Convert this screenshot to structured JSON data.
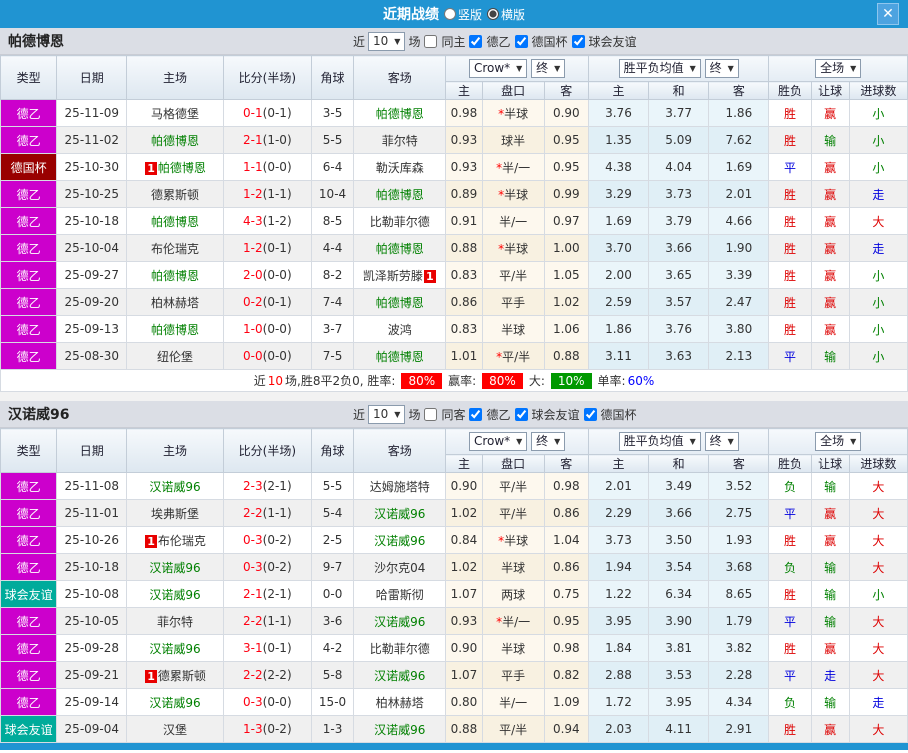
{
  "titlebar": {
    "title": "近期战绩",
    "radios": [
      {
        "label": "竖版",
        "selected": false
      },
      {
        "label": "横版",
        "selected": true
      }
    ],
    "close_label": "X"
  },
  "colors": {
    "titlebar": "#2094d2",
    "types": {
      "德乙": "#cc00cc",
      "德国杯": "#990000",
      "球会友谊": "#00ab9b"
    },
    "highlight_team": "#008000",
    "score_red": "#ff0012"
  },
  "table_header": {
    "left": [
      "类型",
      "日期",
      "主场",
      "比分(半场)",
      "角球",
      "客场"
    ],
    "odds_select": "Crow*",
    "odds_final_select": "终",
    "odds_cols": [
      "主",
      "盘口",
      "客"
    ],
    "mean_select": "胜平负均值",
    "mean_final_select": "终",
    "mean_cols": [
      "主",
      "和",
      "客"
    ],
    "result_select": "全场",
    "result_cols": [
      "胜负",
      "让球",
      "进球数"
    ]
  },
  "sections": [
    {
      "team": "帕德博恩",
      "filter": {
        "near_label": "近",
        "count": "10",
        "games_label": "场",
        "same": {
          "label": "同主",
          "checked": false
        },
        "comps": [
          {
            "label": "德乙",
            "checked": true
          },
          {
            "label": "德国杯",
            "checked": true
          },
          {
            "label": "球会友谊",
            "checked": true
          }
        ]
      },
      "rows": [
        {
          "type": "德乙",
          "date": "25-11-09",
          "home": "马格德堡",
          "home_hl": false,
          "home_badge": "",
          "score": "0-1",
          "half": "(0-1)",
          "corner": "3-5",
          "away": "帕德博恩",
          "away_hl": true,
          "away_badge": "",
          "odds": [
            "0.98",
            "半球",
            "0.90"
          ],
          "star": true,
          "mean": [
            "3.76",
            "3.77",
            "1.86"
          ],
          "res": [
            [
              "胜",
              "r"
            ],
            [
              "赢",
              "r"
            ],
            [
              "小",
              "g"
            ]
          ]
        },
        {
          "type": "德乙",
          "date": "25-11-02",
          "home": "帕德博恩",
          "home_hl": true,
          "home_badge": "",
          "score": "2-1",
          "half": "(1-0)",
          "corner": "5-5",
          "away": "菲尔特",
          "away_hl": false,
          "away_badge": "",
          "odds": [
            "0.93",
            "球半",
            "0.95"
          ],
          "star": false,
          "mean": [
            "1.35",
            "5.09",
            "7.62"
          ],
          "res": [
            [
              "胜",
              "r"
            ],
            [
              "输",
              "g"
            ],
            [
              "小",
              "g"
            ]
          ]
        },
        {
          "type": "德国杯",
          "date": "25-10-30",
          "home": "帕德博恩",
          "home_hl": true,
          "home_badge": "before",
          "score": "1-1",
          "half": "(0-0)",
          "corner": "6-4",
          "away": "勒沃库森",
          "away_hl": false,
          "away_badge": "",
          "odds": [
            "0.93",
            "半/一",
            "0.95"
          ],
          "star": true,
          "mean": [
            "4.38",
            "4.04",
            "1.69"
          ],
          "res": [
            [
              "平",
              "b"
            ],
            [
              "赢",
              "r"
            ],
            [
              "小",
              "g"
            ]
          ]
        },
        {
          "type": "德乙",
          "date": "25-10-25",
          "home": "德累斯顿",
          "home_hl": false,
          "home_badge": "",
          "score": "1-2",
          "half": "(1-1)",
          "corner": "10-4",
          "away": "帕德博恩",
          "away_hl": true,
          "away_badge": "",
          "odds": [
            "0.89",
            "半球",
            "0.99"
          ],
          "star": true,
          "mean": [
            "3.29",
            "3.73",
            "2.01"
          ],
          "res": [
            [
              "胜",
              "r"
            ],
            [
              "赢",
              "r"
            ],
            [
              "走",
              "b"
            ]
          ]
        },
        {
          "type": "德乙",
          "date": "25-10-18",
          "home": "帕德博恩",
          "home_hl": true,
          "home_badge": "",
          "score": "4-3",
          "half": "(1-2)",
          "corner": "8-5",
          "away": "比勒菲尔德",
          "away_hl": false,
          "away_badge": "",
          "odds": [
            "0.91",
            "半/一",
            "0.97"
          ],
          "star": false,
          "mean": [
            "1.69",
            "3.79",
            "4.66"
          ],
          "res": [
            [
              "胜",
              "r"
            ],
            [
              "赢",
              "r"
            ],
            [
              "大",
              "r"
            ]
          ]
        },
        {
          "type": "德乙",
          "date": "25-10-04",
          "home": "布伦瑞克",
          "home_hl": false,
          "home_badge": "",
          "score": "1-2",
          "half": "(0-1)",
          "corner": "4-4",
          "away": "帕德博恩",
          "away_hl": true,
          "away_badge": "",
          "odds": [
            "0.88",
            "半球",
            "1.00"
          ],
          "star": true,
          "mean": [
            "3.70",
            "3.66",
            "1.90"
          ],
          "res": [
            [
              "胜",
              "r"
            ],
            [
              "赢",
              "r"
            ],
            [
              "走",
              "b"
            ]
          ]
        },
        {
          "type": "德乙",
          "date": "25-09-27",
          "home": "帕德博恩",
          "home_hl": true,
          "home_badge": "",
          "score": "2-0",
          "half": "(0-0)",
          "corner": "8-2",
          "away": "凯泽斯劳滕",
          "away_hl": false,
          "away_badge": "after",
          "odds": [
            "0.83",
            "平/半",
            "1.05"
          ],
          "star": false,
          "mean": [
            "2.00",
            "3.65",
            "3.39"
          ],
          "res": [
            [
              "胜",
              "r"
            ],
            [
              "赢",
              "r"
            ],
            [
              "小",
              "g"
            ]
          ]
        },
        {
          "type": "德乙",
          "date": "25-09-20",
          "home": "柏林赫塔",
          "home_hl": false,
          "home_badge": "",
          "score": "0-2",
          "half": "(0-1)",
          "corner": "7-4",
          "away": "帕德博恩",
          "away_hl": true,
          "away_badge": "",
          "odds": [
            "0.86",
            "平手",
            "1.02"
          ],
          "star": false,
          "mean": [
            "2.59",
            "3.57",
            "2.47"
          ],
          "res": [
            [
              "胜",
              "r"
            ],
            [
              "赢",
              "r"
            ],
            [
              "小",
              "g"
            ]
          ]
        },
        {
          "type": "德乙",
          "date": "25-09-13",
          "home": "帕德博恩",
          "home_hl": true,
          "home_badge": "",
          "score": "1-0",
          "half": "(0-0)",
          "corner": "3-7",
          "away": "波鸿",
          "away_hl": false,
          "away_badge": "",
          "odds": [
            "0.83",
            "半球",
            "1.06"
          ],
          "star": false,
          "mean": [
            "1.86",
            "3.76",
            "3.80"
          ],
          "res": [
            [
              "胜",
              "r"
            ],
            [
              "赢",
              "r"
            ],
            [
              "小",
              "g"
            ]
          ]
        },
        {
          "type": "德乙",
          "date": "25-08-30",
          "home": "纽伦堡",
          "home_hl": false,
          "home_badge": "",
          "score": "0-0",
          "half": "(0-0)",
          "corner": "7-5",
          "away": "帕德博恩",
          "away_hl": true,
          "away_badge": "",
          "odds": [
            "1.01",
            "平/半",
            "0.88"
          ],
          "star": true,
          "mean": [
            "3.11",
            "3.63",
            "2.13"
          ],
          "res": [
            [
              "平",
              "b"
            ],
            [
              "输",
              "g"
            ],
            [
              "小",
              "g"
            ]
          ]
        }
      ],
      "summary": {
        "t1": "近",
        "n": "10",
        "t2": "场,胜8平2负0, 胜率:",
        "win_rate": "80%",
        "t3": "赢率:",
        "profit_rate": "80%",
        "t4": "大:",
        "big_rate": "10%",
        "t5": "单率:",
        "single_rate": "60%"
      }
    },
    {
      "team": "汉诺威96",
      "filter": {
        "near_label": "近",
        "count": "10",
        "games_label": "场",
        "same": {
          "label": "同客",
          "checked": false
        },
        "comps": [
          {
            "label": "德乙",
            "checked": true
          },
          {
            "label": "球会友谊",
            "checked": true
          },
          {
            "label": "德国杯",
            "checked": true
          }
        ]
      },
      "rows": [
        {
          "type": "德乙",
          "date": "25-11-08",
          "home": "汉诺威96",
          "home_hl": true,
          "home_badge": "",
          "score": "2-3",
          "half": "(2-1)",
          "corner": "5-5",
          "away": "达姆施塔特",
          "away_hl": false,
          "away_badge": "",
          "odds": [
            "0.90",
            "平/半",
            "0.98"
          ],
          "star": false,
          "mean": [
            "2.01",
            "3.49",
            "3.52"
          ],
          "res": [
            [
              "负",
              "g"
            ],
            [
              "输",
              "g"
            ],
            [
              "大",
              "r"
            ]
          ]
        },
        {
          "type": "德乙",
          "date": "25-11-01",
          "home": "埃弗斯堡",
          "home_hl": false,
          "home_badge": "",
          "score": "2-2",
          "half": "(1-1)",
          "corner": "5-4",
          "away": "汉诺威96",
          "away_hl": true,
          "away_badge": "",
          "odds": [
            "1.02",
            "平/半",
            "0.86"
          ],
          "star": false,
          "mean": [
            "2.29",
            "3.66",
            "2.75"
          ],
          "res": [
            [
              "平",
              "b"
            ],
            [
              "赢",
              "r"
            ],
            [
              "大",
              "r"
            ]
          ]
        },
        {
          "type": "德乙",
          "date": "25-10-26",
          "home": "布伦瑞克",
          "home_hl": false,
          "home_badge": "before",
          "score": "0-3",
          "half": "(0-2)",
          "corner": "2-5",
          "away": "汉诺威96",
          "away_hl": true,
          "away_badge": "",
          "odds": [
            "0.84",
            "半球",
            "1.04"
          ],
          "star": true,
          "mean": [
            "3.73",
            "3.50",
            "1.93"
          ],
          "res": [
            [
              "胜",
              "r"
            ],
            [
              "赢",
              "r"
            ],
            [
              "大",
              "r"
            ]
          ]
        },
        {
          "type": "德乙",
          "date": "25-10-18",
          "home": "汉诺威96",
          "home_hl": true,
          "home_badge": "",
          "score": "0-3",
          "half": "(0-2)",
          "corner": "9-7",
          "away": "沙尔克04",
          "away_hl": false,
          "away_badge": "",
          "odds": [
            "1.02",
            "半球",
            "0.86"
          ],
          "star": false,
          "mean": [
            "1.94",
            "3.54",
            "3.68"
          ],
          "res": [
            [
              "负",
              "g"
            ],
            [
              "输",
              "g"
            ],
            [
              "大",
              "r"
            ]
          ]
        },
        {
          "type": "球会友谊",
          "date": "25-10-08",
          "home": "汉诺威96",
          "home_hl": true,
          "home_badge": "",
          "score": "2-1",
          "half": "(2-1)",
          "corner": "0-0",
          "away": "哈雷斯彻",
          "away_hl": false,
          "away_badge": "",
          "odds": [
            "1.07",
            "两球",
            "0.75"
          ],
          "star": false,
          "mean": [
            "1.22",
            "6.34",
            "8.65"
          ],
          "res": [
            [
              "胜",
              "r"
            ],
            [
              "输",
              "g"
            ],
            [
              "小",
              "g"
            ]
          ]
        },
        {
          "type": "德乙",
          "date": "25-10-05",
          "home": "菲尔特",
          "home_hl": false,
          "home_badge": "",
          "score": "2-2",
          "half": "(1-1)",
          "corner": "3-6",
          "away": "汉诺威96",
          "away_hl": true,
          "away_badge": "",
          "odds": [
            "0.93",
            "半/一",
            "0.95"
          ],
          "star": true,
          "mean": [
            "3.95",
            "3.90",
            "1.79"
          ],
          "res": [
            [
              "平",
              "b"
            ],
            [
              "输",
              "g"
            ],
            [
              "大",
              "r"
            ]
          ]
        },
        {
          "type": "德乙",
          "date": "25-09-28",
          "home": "汉诺威96",
          "home_hl": true,
          "home_badge": "",
          "score": "3-1",
          "half": "(0-1)",
          "corner": "4-2",
          "away": "比勒菲尔德",
          "away_hl": false,
          "away_badge": "",
          "odds": [
            "0.90",
            "半球",
            "0.98"
          ],
          "star": false,
          "mean": [
            "1.84",
            "3.81",
            "3.82"
          ],
          "res": [
            [
              "胜",
              "r"
            ],
            [
              "赢",
              "r"
            ],
            [
              "大",
              "r"
            ]
          ]
        },
        {
          "type": "德乙",
          "date": "25-09-21",
          "home": "德累斯顿",
          "home_hl": false,
          "home_badge": "before",
          "score": "2-2",
          "half": "(2-2)",
          "corner": "5-8",
          "away": "汉诺威96",
          "away_hl": true,
          "away_badge": "",
          "odds": [
            "1.07",
            "平手",
            "0.82"
          ],
          "star": false,
          "mean": [
            "2.88",
            "3.53",
            "2.28"
          ],
          "res": [
            [
              "平",
              "b"
            ],
            [
              "走",
              "b"
            ],
            [
              "大",
              "r"
            ]
          ]
        },
        {
          "type": "德乙",
          "date": "25-09-14",
          "home": "汉诺威96",
          "home_hl": true,
          "home_badge": "",
          "score": "0-3",
          "half": "(0-0)",
          "corner": "15-0",
          "away": "柏林赫塔",
          "away_hl": false,
          "away_badge": "",
          "odds": [
            "0.80",
            "半/一",
            "1.09"
          ],
          "star": false,
          "mean": [
            "1.72",
            "3.95",
            "4.34"
          ],
          "res": [
            [
              "负",
              "g"
            ],
            [
              "输",
              "g"
            ],
            [
              "走",
              "b"
            ]
          ]
        },
        {
          "type": "球会友谊",
          "date": "25-09-04",
          "home": "汉堡",
          "home_hl": false,
          "home_badge": "",
          "score": "1-3",
          "half": "(0-2)",
          "corner": "1-3",
          "away": "汉诺威96",
          "away_hl": true,
          "away_badge": "",
          "odds": [
            "0.88",
            "平/半",
            "0.94"
          ],
          "star": false,
          "mean": [
            "2.03",
            "4.11",
            "2.91"
          ],
          "res": [
            [
              "胜",
              "r"
            ],
            [
              "赢",
              "r"
            ],
            [
              "大",
              "r"
            ]
          ]
        }
      ],
      "summary": null
    }
  ]
}
